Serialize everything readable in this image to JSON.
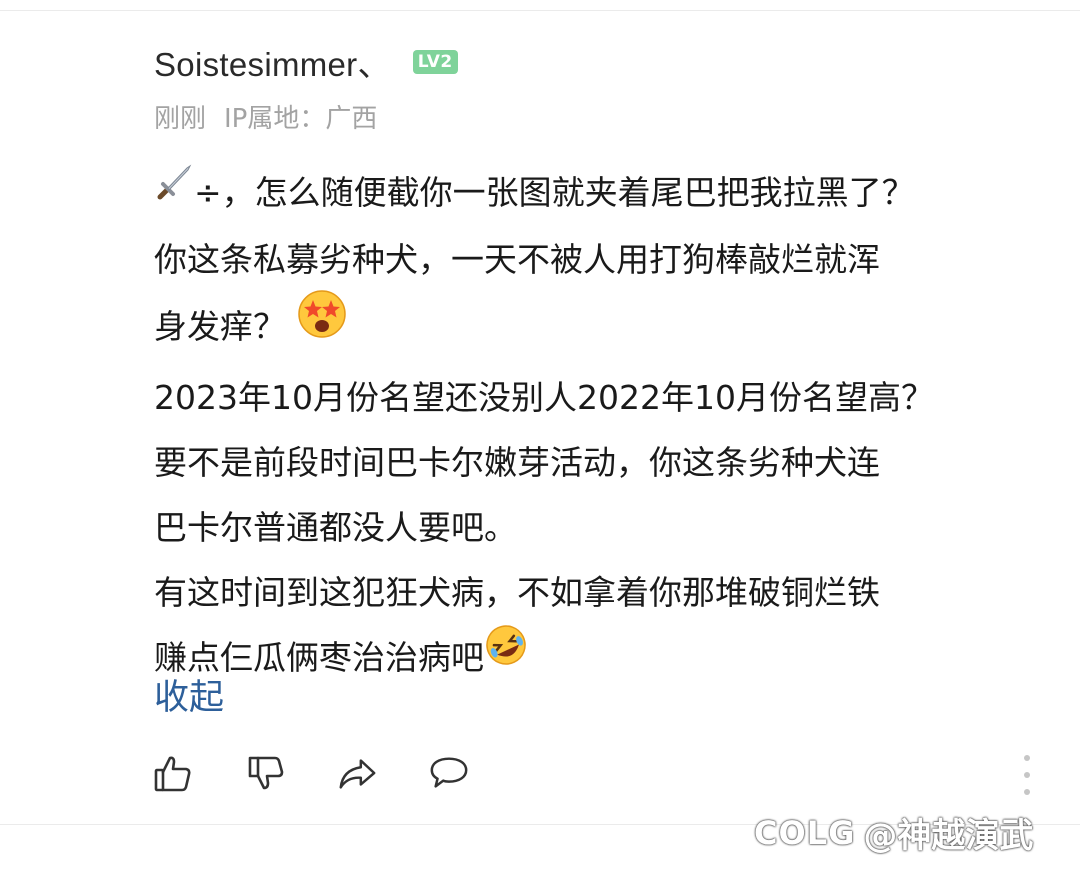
{
  "comment": {
    "username": "Soistesimmer、",
    "level": "LV2",
    "time": "刚刚",
    "ip_location": "IP属地：广西",
    "lines": [
      "÷，怎么随便截你一张图就夹着尾巴把我拉黑了？",
      "你这条私募劣种犬，一天不被人用打狗棒敲烂就浑",
      "身发痒？",
      "2023年10月份名望还没别人2022年10月份名望高？",
      "要不是前段时间巴卡尔嫩芽活动，你这条劣种犬连",
      "巴卡尔普通都没人要吧。",
      "有这时间到这犯狂犬病，不如拿着你那堆破铜烂铁",
      "赚点仨瓜俩枣治治病吧"
    ],
    "collapse_label": "收起"
  },
  "icons": {
    "sword": "sword-emoji-icon",
    "starstruck": "starstruck-emoji-icon",
    "rofl": "rofl-emoji-icon",
    "like": "thumbs-up-icon",
    "dislike": "thumbs-down-icon",
    "share": "share-icon",
    "reply": "comment-icon",
    "more": "more-vertical-icon"
  },
  "colors": {
    "level_badge": "#7fd39a",
    "link": "#2d5f9a",
    "meta": "#a3a3a3"
  },
  "watermark": {
    "logo": "COLG",
    "text": "@神越演武"
  }
}
